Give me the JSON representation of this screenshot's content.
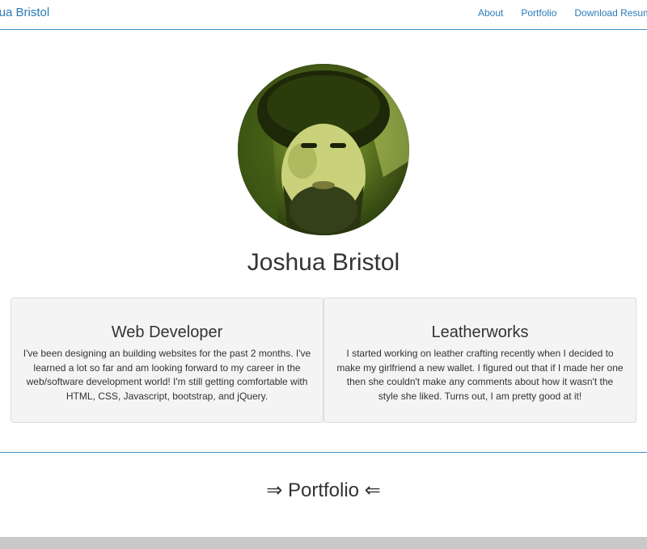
{
  "navbar": {
    "brand": "Joshua Bristol",
    "links": [
      "About",
      "Portfolio",
      "Download Resume"
    ]
  },
  "profile": {
    "name": "Joshua Bristol"
  },
  "cards": [
    {
      "title": "Web Developer",
      "body": "I've been designing an building websites for the past 2 months. I've learned a lot so far and am looking forward to my career in the web/software development world! I'm still getting comfortable with HTML, CSS, Javascript, bootstrap, and jQuery."
    },
    {
      "title": "Leatherworks",
      "body": "I started working on leather crafting recently when I decided to make my girlfriend a new wallet. I figured out that if I made her one then she couldn't make any comments about how it wasn't the style she liked. Turns out, I am pretty good at it!"
    }
  ],
  "portfolio": {
    "heading": "⇒ Portfolio ⇐"
  },
  "colors": {
    "accent": "#2a7ab8",
    "divider": "#3d8fc4",
    "card_bg": "#f4f4f4",
    "footer": "#c9c9c9"
  }
}
